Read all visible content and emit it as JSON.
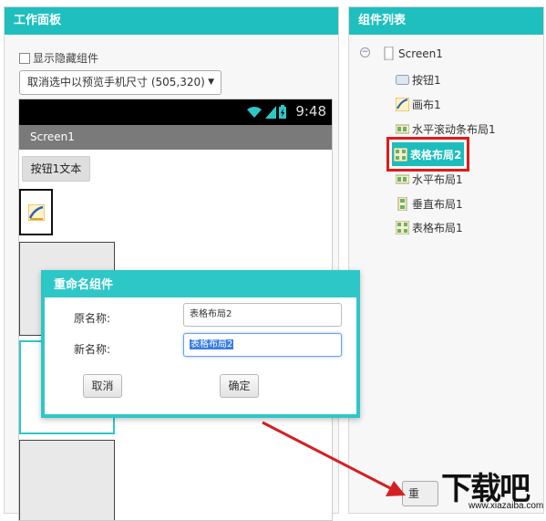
{
  "work_panel": {
    "title": "工作面板",
    "show_hidden_label": "显示隐藏组件",
    "preview_select": "取消选中以预览手机尺寸 (505,320)"
  },
  "phone": {
    "time": "9:48",
    "screen_title": "Screen1",
    "button_text": "按钮1文本"
  },
  "list_panel": {
    "title": "组件列表",
    "root": "Screen1",
    "items": [
      {
        "label": "按钮1",
        "icon": "button-icon"
      },
      {
        "label": "画布1",
        "icon": "canvas-icon"
      },
      {
        "label": "水平滚动条布局1",
        "icon": "horizontal-scroll-layout-icon"
      },
      {
        "label": "表格布局2",
        "icon": "table-layout-icon",
        "selected": true
      },
      {
        "label": "水平布局1",
        "icon": "horizontal-layout-icon"
      },
      {
        "label": "垂直布局1",
        "icon": "vertical-layout-icon"
      },
      {
        "label": "表格布局1",
        "icon": "table-layout-icon"
      }
    ]
  },
  "dialog": {
    "title": "重命名组件",
    "old_name_label": "原名称:",
    "old_name_value": "表格布局2",
    "new_name_label": "新名称:",
    "new_name_value": "表格布局2",
    "cancel_label": "取消",
    "ok_label": "确定"
  },
  "bottom": {
    "rename_button_partial": "重"
  },
  "watermark": {
    "main": "下载吧",
    "sub": "www.xiazaiba.com"
  },
  "colors": {
    "accent": "#1fbfbf",
    "highlight_border": "#dd1b1b",
    "arrow": "#d42020"
  }
}
